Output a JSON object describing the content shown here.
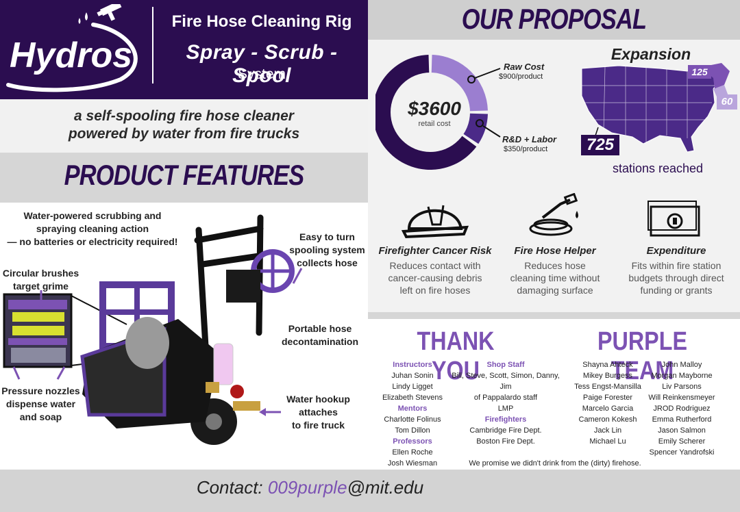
{
  "brand": {
    "logo_text": "Hydros",
    "rig_title": "Fire Hose Cleaning Rig",
    "slogan": "Spray - Scrub - Spool",
    "slogan_sub": "System"
  },
  "tagline": {
    "line1": "a self-spooling fire hose cleaner",
    "line2": "powered by water from fire trucks"
  },
  "features": {
    "title": "PRODUCT FEATURES",
    "callouts": {
      "water_powered": [
        "Water-powered scrubbing and",
        "spraying cleaning action",
        "— no batteries or electricity required!"
      ],
      "brushes": [
        "Circular brushes",
        "target grime"
      ],
      "nozzles": [
        "Pressure nozzles",
        "dispense water",
        "and soap"
      ],
      "spooling": [
        "Easy to turn",
        "spooling system",
        "collects hose"
      ],
      "portable": [
        "Portable hose",
        "decontamination"
      ],
      "hookup": [
        "Water hookup attaches",
        "to fire truck"
      ]
    }
  },
  "proposal": {
    "title": "OUR PROPOSAL",
    "price": "$3600",
    "price_sub": "retail cost",
    "cost_breakdown": [
      {
        "label": "Raw Cost",
        "value": "$900/product",
        "amount": 900
      },
      {
        "label": "R&D + Labor",
        "value": "$350/product",
        "amount": 350
      }
    ],
    "expansion": {
      "title": "Expansion",
      "badges": [
        "725",
        "125",
        "60"
      ],
      "stations_label": "stations reached"
    },
    "benefits": [
      {
        "icon": "firefighter-helmet-icon",
        "title": "Firefighter Cancer Risk",
        "text": [
          "Reduces contact with",
          "cancer-causing debris",
          "left on fire hoses"
        ]
      },
      {
        "icon": "fire-hose-icon",
        "title": "Fire Hose Helper",
        "text": [
          "Reduces hose",
          "cleaning time without",
          "damaging surface"
        ]
      },
      {
        "icon": "money-bill-icon",
        "title": "Expenditure",
        "text": [
          "Fits within fire station",
          "budgets through direct",
          "funding or grants"
        ]
      }
    ]
  },
  "thanks": {
    "title": "THANK YOU",
    "col1": [
      {
        "h": "Instructors"
      },
      {
        "t": "Juhan Sonin"
      },
      {
        "t": "Lindy Ligget"
      },
      {
        "t": "Elizabeth Stevens"
      },
      {
        "h": "Mentors"
      },
      {
        "t": "Charlotte Folinus"
      },
      {
        "t": "Tom Dillon"
      },
      {
        "h": "Professors"
      },
      {
        "t": "Ellen Roche"
      },
      {
        "t": "Josh Wiesman"
      }
    ],
    "col2": [
      {
        "h": "Shop Staff"
      },
      {
        "t": "Bill, Steve, Scott, Simon, Danny, Jim"
      },
      {
        "t": "of Pappalardo staff"
      },
      {
        "t": "LMP"
      },
      {
        "h": "Firefighters"
      },
      {
        "t": "Cambridge Fire Dept."
      },
      {
        "t": "Boston Fire Dept."
      }
    ],
    "promise": "We promise we didn't drink from the (dirty) firehose."
  },
  "team": {
    "title": "PURPLE TEAM",
    "col1": [
      "Shayna Ahteck",
      "Mikey Burgess",
      "Tess Engst-Mansilla",
      "Paige Forester",
      "Marcelo Garcia",
      "Cameron Kokesh",
      "Jack Lin",
      "Michael Lu"
    ],
    "col2": [
      "John Malloy",
      "Morgan Mayborne",
      "Liv Parsons",
      "Will Reinkensmeyer",
      "JROD Rodriguez",
      "Emma Rutherford",
      "Jason Salmon",
      "Emily Scherer",
      "Spencer Yandrofski"
    ]
  },
  "contact": {
    "prefix": "Contact: ",
    "user": "009purple",
    "domain": "@mit.edu"
  },
  "colors": {
    "dark_purple": "#2b0d50",
    "purple": "#7c52b3",
    "light_purple": "#9b7ed0",
    "mid_purple": "#4b2a88"
  }
}
